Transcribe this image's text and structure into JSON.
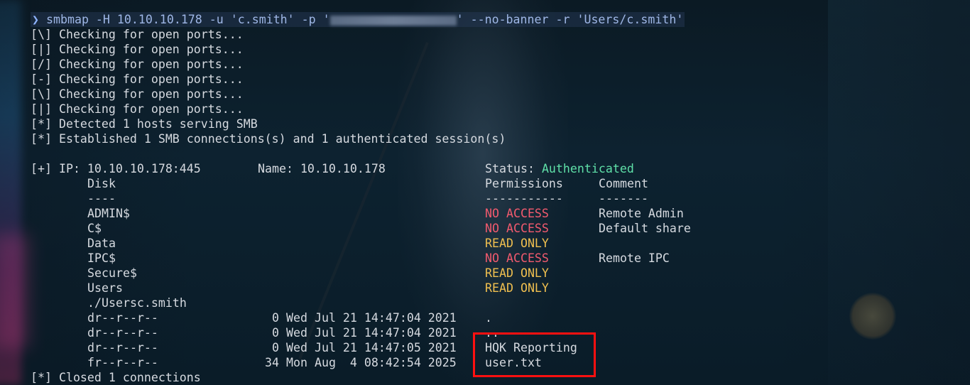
{
  "command": {
    "prompt_symbol": "❯",
    "pre": "smbmap -H 10.10.10.178 -u 'c.smith' -p '",
    "post": "' --no-banner -r 'Users/c.smith'"
  },
  "progress_lines": [
    "[\\] Checking for open ports...",
    "[|] Checking for open ports...",
    "[/] Checking for open ports...",
    "[-] Checking for open ports...",
    "[\\] Checking for open ports...",
    "[|] Checking for open ports...",
    "[*] Detected 1 hosts serving SMB",
    "[*] Established 1 SMB connections(s) and 1 authenticated session(s)"
  ],
  "host": {
    "ip_label": "[+] IP: 10.10.10.178:445",
    "name_label": "Name: 10.10.10.178",
    "status_label": "Status: ",
    "status_value": "Authenticated"
  },
  "shares_header": {
    "disk": "Disk",
    "permissions": "Permissions",
    "comment": "Comment",
    "disk_sep": "----",
    "permissions_sep": "-----------",
    "comment_sep": "-------"
  },
  "shares": [
    {
      "name": "ADMIN$",
      "permission": "NO ACCESS",
      "comment": "Remote Admin"
    },
    {
      "name": "C$",
      "permission": "NO ACCESS",
      "comment": "Default share"
    },
    {
      "name": "Data",
      "permission": "READ ONLY",
      "comment": ""
    },
    {
      "name": "IPC$",
      "permission": "NO ACCESS",
      "comment": "Remote IPC"
    },
    {
      "name": "Secure$",
      "permission": "READ ONLY",
      "comment": ""
    },
    {
      "name": "Users",
      "permission": "READ ONLY",
      "comment": ""
    }
  ],
  "listing_path": "./Usersc.smith",
  "listing": [
    {
      "mode": "dr--r--r--",
      "size": "0",
      "date": "Wed Jul 21 14:47:04 2021",
      "name": "."
    },
    {
      "mode": "dr--r--r--",
      "size": "0",
      "date": "Wed Jul 21 14:47:04 2021",
      "name": ".."
    },
    {
      "mode": "dr--r--r--",
      "size": "0",
      "date": "Wed Jul 21 14:47:05 2021",
      "name": "HQK Reporting"
    },
    {
      "mode": "fr--r--r--",
      "size": "34",
      "date": "Mon Aug  4 08:42:54 2025",
      "name": "user.txt"
    }
  ],
  "closing_line": "[*] Closed 1 connections",
  "colors": {
    "authenticated": "#5fe0a8",
    "no_access": "#f25a6e",
    "read_only": "#f0bf4f",
    "highlight": "#ff1010"
  }
}
